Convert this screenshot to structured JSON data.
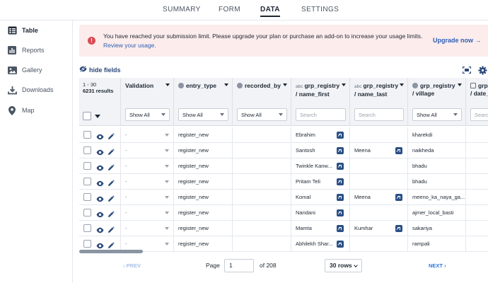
{
  "nav": {
    "tabs": [
      "SUMMARY",
      "FORM",
      "DATA",
      "SETTINGS"
    ],
    "active": "DATA"
  },
  "sidebar": {
    "items": [
      {
        "label": "Table",
        "icon": "table-icon",
        "active": true
      },
      {
        "label": "Reports",
        "icon": "bar-chart-icon",
        "active": false
      },
      {
        "label": "Gallery",
        "icon": "image-icon",
        "active": false
      },
      {
        "label": "Downloads",
        "icon": "download-icon",
        "active": false
      },
      {
        "label": "Map",
        "icon": "map-pin-icon",
        "active": false
      }
    ]
  },
  "banner": {
    "message": "You have reached your submission limit. Please upgrade your plan or purchase an add-on to increase your usage limits.",
    "link": "Review your usage.",
    "cta": "Upgrade now"
  },
  "toolbar": {
    "hide_fields": "hide fields"
  },
  "table": {
    "range": "1 - 30",
    "results": "6231 results",
    "columns": [
      {
        "title": "Validation",
        "type_label": "",
        "filter": "Show All"
      },
      {
        "title": "entry_type",
        "type_label": "",
        "filter": "Show All"
      },
      {
        "title": "recorded_by",
        "type_label": "",
        "filter": "Show All"
      },
      {
        "title": "grp_registry",
        "subtitle": "/ name_first",
        "type_label": "abc",
        "filter": "Search"
      },
      {
        "title": "grp_registry",
        "subtitle": "/ name_last",
        "type_label": "abc",
        "filter": "Search"
      },
      {
        "title": "grp_registry",
        "subtitle": "/ village",
        "type_label": "",
        "filter": "Show All"
      },
      {
        "title": "grp",
        "subtitle": "/ date_re",
        "type_label": "",
        "filter": "Search"
      }
    ],
    "rows": [
      {
        "validation": "-",
        "entry_type": "register_new",
        "recorded_by": "",
        "name_first": "Ebrahim",
        "name_last": "",
        "village": "kharekdi"
      },
      {
        "validation": "-",
        "entry_type": "register_new",
        "recorded_by": "",
        "name_first": "Santosh",
        "name_last": "Meena",
        "village": "naikheda"
      },
      {
        "validation": "-",
        "entry_type": "register_new",
        "recorded_by": "",
        "name_first": "Twinkle Kanw...",
        "name_last": "",
        "village": "bhadu"
      },
      {
        "validation": "-",
        "entry_type": "register_new",
        "recorded_by": "",
        "name_first": "Pritam Teli",
        "name_last": "",
        "village": "bhadu"
      },
      {
        "validation": "-",
        "entry_type": "register_new",
        "recorded_by": "",
        "name_first": "Komal",
        "name_last": "Meena",
        "village": "meeno_ka_naya_ga..."
      },
      {
        "validation": "-",
        "entry_type": "register_new",
        "recorded_by": "",
        "name_first": "Nandani",
        "name_last": "",
        "village": "ajmer_local_basti"
      },
      {
        "validation": "-",
        "entry_type": "register_new",
        "recorded_by": "",
        "name_first": "Mamta",
        "name_last": "Kumhar",
        "village": "sakariya"
      },
      {
        "validation": "-",
        "entry_type": "register_new",
        "recorded_by": "",
        "name_first": "Abhilekh Shar...",
        "name_last": "",
        "village": "rampali"
      }
    ]
  },
  "pager": {
    "prev": "PREV",
    "page_label": "Page",
    "page_value": "1",
    "of_label": "of 208",
    "rows": "30 rows",
    "next": "NEXT"
  }
}
